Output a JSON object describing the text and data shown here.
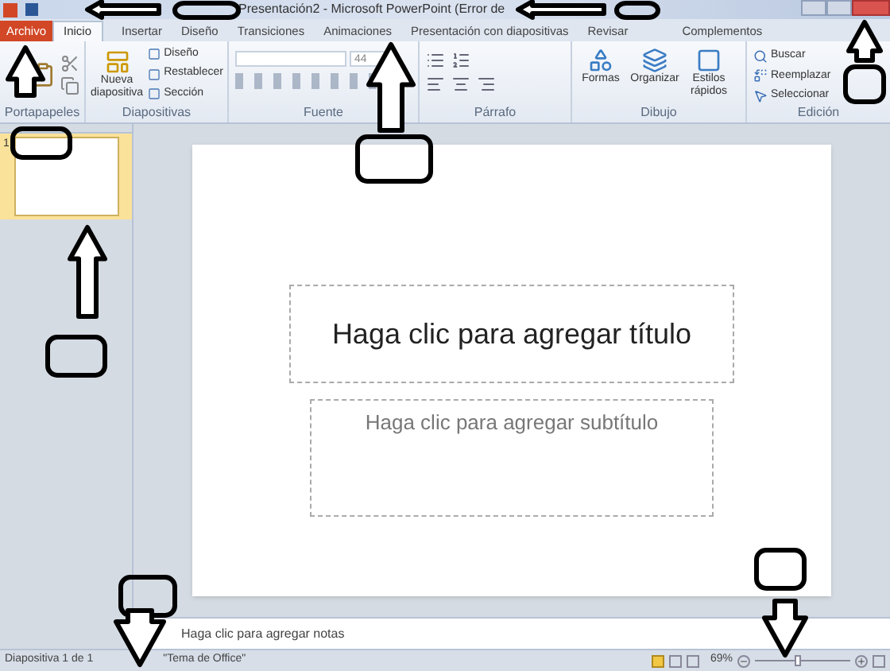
{
  "window": {
    "title": "Presentación2 - Microsoft PowerPoint (Error de"
  },
  "tabs": [
    {
      "label": "Archivo",
      "kind": "file",
      "selected": false
    },
    {
      "label": "Inicio",
      "kind": "tab",
      "selected": true
    },
    {
      "label": "Insertar",
      "kind": "tab",
      "selected": false
    },
    {
      "label": "Diseño",
      "kind": "tab",
      "selected": false
    },
    {
      "label": "Transiciones",
      "kind": "tab",
      "selected": false
    },
    {
      "label": "Animaciones",
      "kind": "tab",
      "selected": false
    },
    {
      "label": "Presentación con diapositivas",
      "kind": "tab",
      "selected": false
    },
    {
      "label": "Revisar",
      "kind": "tab",
      "selected": false
    },
    {
      "label": "Complementos",
      "kind": "tab",
      "selected": false
    }
  ],
  "ribbon": {
    "groups": [
      {
        "label": "Portapapeles"
      },
      {
        "label": "Diapositivas",
        "buttons": [
          "Nueva diapositiva"
        ],
        "small": [
          "Diseño",
          "Restablecer",
          "Sección"
        ]
      },
      {
        "label": "Fuente",
        "font_size": "44"
      },
      {
        "label": "Párrafo"
      },
      {
        "label": "Dibujo",
        "buttons": [
          "Formas",
          "Organizar",
          "Estilos rápidos"
        ]
      },
      {
        "label": "Edición",
        "small": [
          "Buscar",
          "Reemplazar",
          "Seleccionar"
        ]
      }
    ]
  },
  "thumbnails": [
    {
      "number": "1",
      "selected": true
    }
  ],
  "slide": {
    "title_placeholder": "Haga clic para agregar título",
    "subtitle_placeholder": "Haga clic para agregar subtítulo"
  },
  "notes": {
    "placeholder": "Haga clic para agregar notas"
  },
  "status_bar": {
    "slide": "Diapositiva 1 de 1",
    "theme": "\"Tema de Office\"",
    "zoom": "69%",
    "zoom_slider": {
      "level": 0.45
    }
  }
}
